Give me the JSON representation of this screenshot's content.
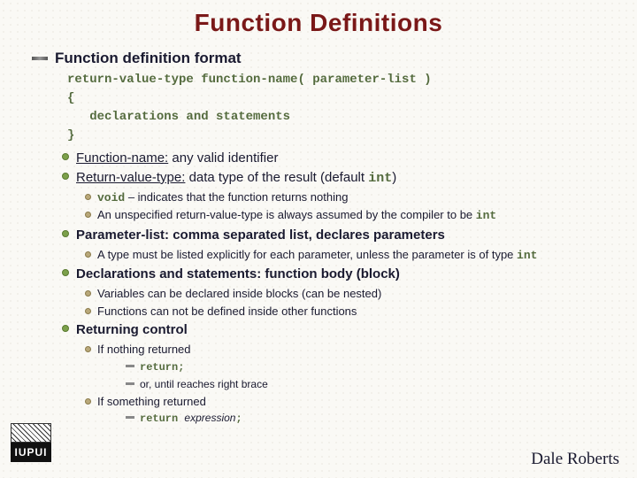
{
  "title": "Function Definitions",
  "section": "Function definition format",
  "code_lines": [
    "return-value-type function-name( parameter-list )",
    "{",
    "   declarations and statements",
    "}"
  ],
  "fn_name_lead": "Function-name:",
  "fn_name_rest": " any valid identifier",
  "rvt_lead": "Return-value-type:",
  "rvt_rest_a": " data type of the result (default ",
  "rvt_code": "int",
  "rvt_rest_b": ")",
  "void_code": "void",
  "void_rest": " – indicates that the function returns nothing",
  "unspec_a": "An unspecified return-value-type is always assumed by the compiler to be ",
  "unspec_code": "int",
  "plist_head": "Parameter-list: comma separated list, declares parameters",
  "plist_sub_a": "A type must be listed explicitly for each parameter, unless the parameter is of type ",
  "plist_sub_code": "int",
  "decl_head": "Declarations and statements: function body (block)",
  "decl_sub1": "Variables can be declared inside blocks (can be nested)",
  "decl_sub2": "Functions can not be defined inside other functions",
  "ret_head": "Returning control",
  "ret_nothing": "If nothing returned",
  "ret_return": "return;",
  "ret_or": "or, until reaches right brace",
  "ret_something": "If something returned",
  "ret_expr_code": "return ",
  "ret_expr_em": "expression",
  "ret_expr_semi": ";",
  "author": "Dale Roberts",
  "logo_text": "IUPUI"
}
